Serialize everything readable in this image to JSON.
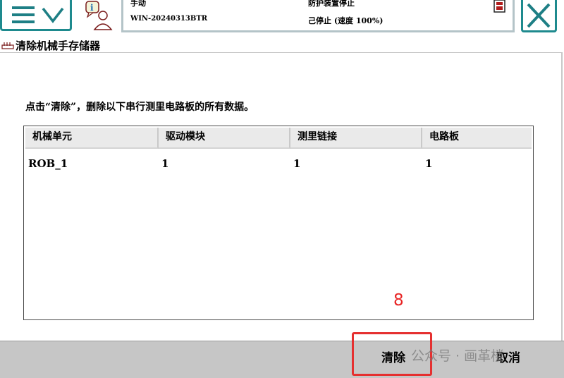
{
  "colors": {
    "accent": "#1e8a8e",
    "highlight": "#e53030",
    "bottom_bar": "#c6c6c6"
  },
  "header": {
    "menu_icons": [
      "menu-icon",
      "chevron-down-icon"
    ],
    "info_icon": "info-user-icon",
    "mode_label": "手动",
    "controller_name": "WIN-20240313BTR",
    "safety_status": "防护装置停止",
    "run_status": "己停止 (速度 100%)",
    "close_icon": "close-icon"
  },
  "page": {
    "title": "清除机械手存储器",
    "instruction": "点击“清除”，删除以下串行测里电路板的所有数据。"
  },
  "table": {
    "columns": [
      "机械单元",
      "驱动模块",
      "测里链接",
      "电路板"
    ],
    "rows": [
      [
        "ROB_1",
        "1",
        "1",
        "1"
      ]
    ]
  },
  "annotation": {
    "step_number": "8"
  },
  "footer": {
    "clear_label": "清除",
    "cancel_label": "取消",
    "watermark": "公众号 · 画革楼"
  }
}
